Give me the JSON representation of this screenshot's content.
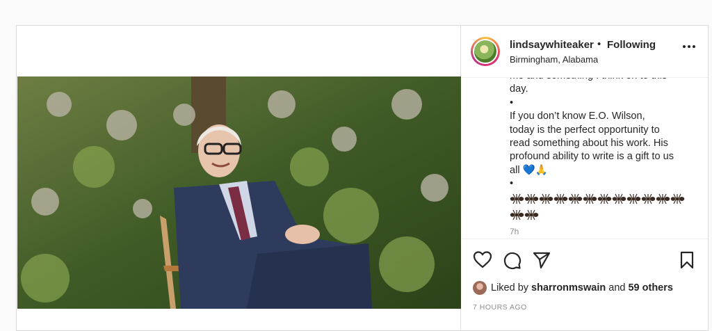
{
  "post": {
    "username": "lindsaywhiteaker",
    "separator": "•",
    "follow_status": "Following",
    "location": "Birmingham, Alabama",
    "caption": {
      "text": "me and something I think on to this\nday.\n•\nIf you don’t know E.O. Wilson,\ntoday is the perfect opportunity to\nread something about his work. His\nprofound ability to write is a gift to us\nall 💙🙏\n•",
      "ant_emoji_count": 14,
      "timestamp_short": "7h"
    },
    "liked_by_prefix": "Liked by",
    "liked_by_user": "sharronmswain",
    "liked_by_conjunction": "and",
    "liked_by_others": "59 others",
    "timestamp_full": "7 HOURS AGO"
  },
  "icons": {
    "more": "more-options-icon",
    "like": "heart-icon",
    "comment": "comment-icon",
    "share": "send-icon",
    "save": "bookmark-icon",
    "ant": "ant-emoji-icon"
  },
  "colors": {
    "text": "#262626",
    "muted": "#8e8e8e",
    "border": "#dbdbdb",
    "background": "#fafafa"
  }
}
